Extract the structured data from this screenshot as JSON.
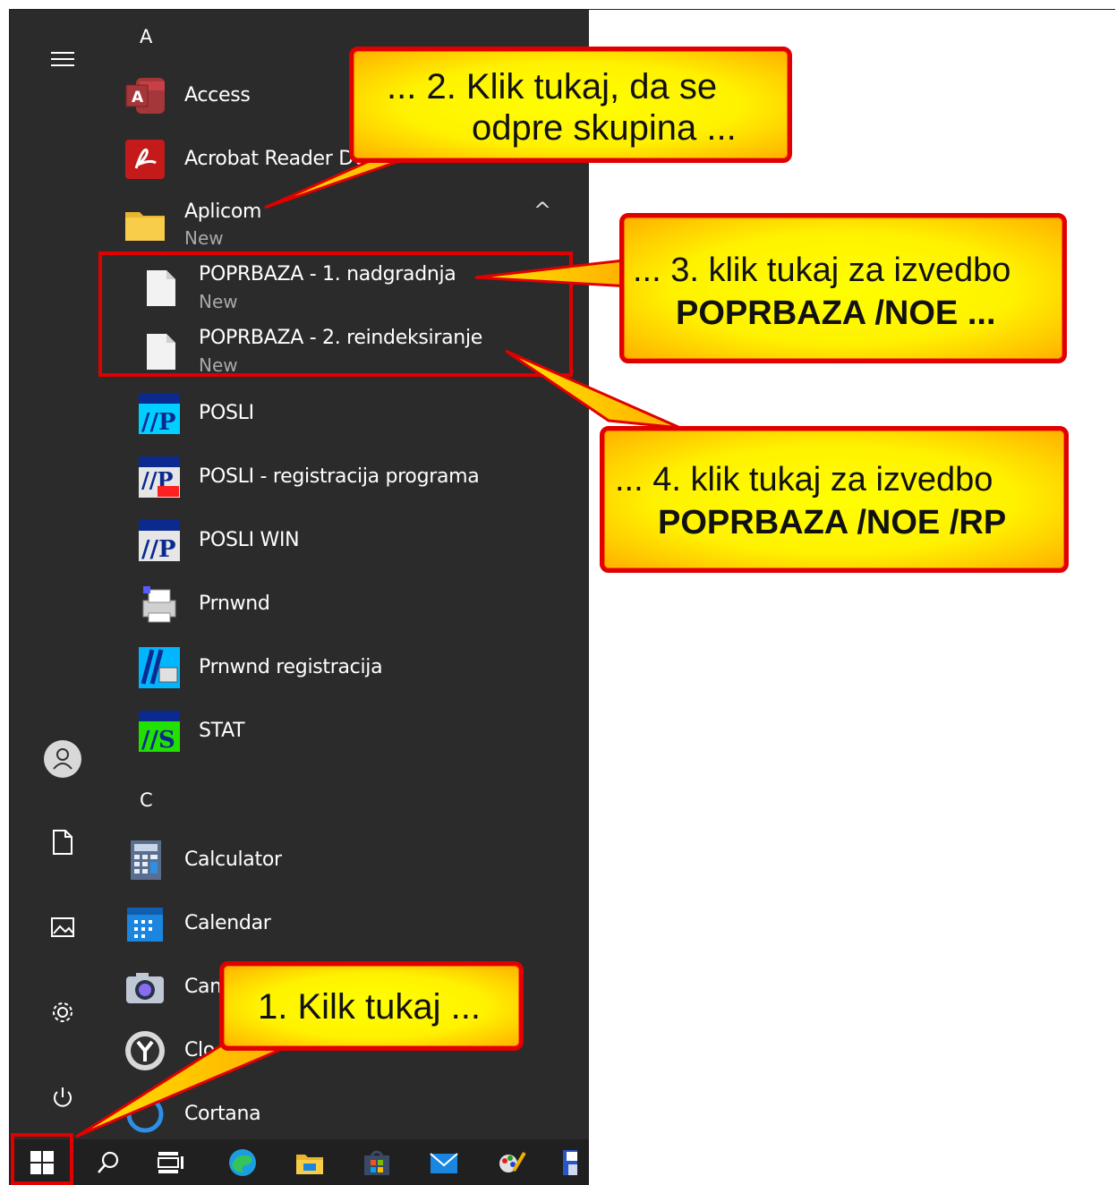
{
  "start_menu": {
    "letters": [
      "A",
      "C"
    ],
    "apps": [
      {
        "label": "Access",
        "icon": "access-icon"
      },
      {
        "label": "Acrobat Reader DC",
        "icon": "acrobat-icon"
      },
      {
        "label": "Aplicom",
        "sub": "New",
        "icon": "folder-icon"
      },
      {
        "label": "POPRBAZA - 1. nadgradnja",
        "sub": "New",
        "icon": "document-icon"
      },
      {
        "label": "POPRBAZA - 2. reindeksiranje",
        "sub": "New",
        "icon": "document-icon"
      },
      {
        "label": "POSLI",
        "icon": "posli-icon"
      },
      {
        "label": "POSLI - registracija programa",
        "icon": "posli-regis-icon"
      },
      {
        "label": "POSLI WIN",
        "icon": "posli-win-icon"
      },
      {
        "label": "Prnwnd",
        "icon": "printer-icon"
      },
      {
        "label": "Prnwnd registracija",
        "icon": "prnwnd-reg-icon"
      },
      {
        "label": "STAT",
        "icon": "stat-icon"
      },
      {
        "label": "Calculator",
        "icon": "calculator-icon"
      },
      {
        "label": "Calendar",
        "icon": "calendar-icon"
      },
      {
        "label": "Camera",
        "icon": "camera-icon"
      },
      {
        "label": "Clock",
        "icon": "clock-icon"
      },
      {
        "label": "Cortana",
        "icon": "cortana-icon"
      }
    ],
    "group_chevron": "^",
    "rail": [
      "hamburger-icon",
      "user-icon",
      "documents-icon",
      "pictures-icon",
      "settings-icon",
      "power-icon"
    ]
  },
  "taskbar": [
    "windows-start-icon",
    "search-icon",
    "task-view-icon",
    "edge-icon",
    "file-explorer-icon",
    "store-icon",
    "mail-icon",
    "paint-icon",
    "save-icon"
  ],
  "callouts": {
    "c1": {
      "line1": "1. Kilk tukaj ..."
    },
    "c2": {
      "line1": "... 2. Klik tukaj, da se",
      "line2": "odpre skupina ..."
    },
    "c3": {
      "line1": "... 3. klik tukaj za izvedbo",
      "line2": "POPRBAZA /NOE ..."
    },
    "c4": {
      "line1": "... 4. klik tukaj za izvedbo",
      "line2": "POPRBAZA /NOE /RP"
    }
  },
  "colors": {
    "menu_bg": "#2b2b2b",
    "taskbar_bg": "#202020",
    "callout_fill": "#ffff00",
    "callout_border": "#e00000"
  }
}
